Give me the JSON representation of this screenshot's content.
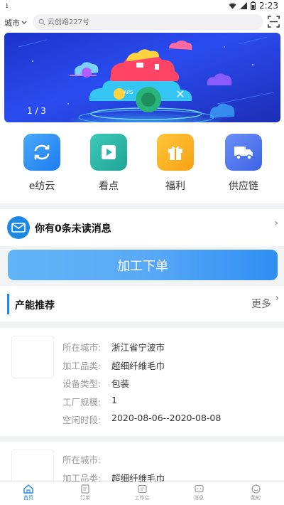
{
  "status_bar": {
    "time": "2:23",
    "download_icon": "download-icon"
  },
  "header": {
    "city_label": "城市",
    "search_placeholder": "云创路227号"
  },
  "banner": {
    "indicator": "1 / 3",
    "cloud_labels": {
      "aps": "APS"
    }
  },
  "quick_menu": [
    {
      "label": "e纺云",
      "icon": "sync-icon",
      "color": "#2f8ef3"
    },
    {
      "label": "看点",
      "icon": "play-icon",
      "color": "#2cb5a6"
    },
    {
      "label": "福利",
      "icon": "gift-icon",
      "color": "#fbb322"
    },
    {
      "label": "供应链",
      "icon": "truck-icon",
      "color": "#4a74ef"
    }
  ],
  "notice": {
    "text": "你有0条未读消息"
  },
  "process_button": {
    "label": "加工下单"
  },
  "section": {
    "title": "产能推荐",
    "more_label": "更多"
  },
  "cards": [
    {
      "rows": [
        {
          "label": "所在城市:",
          "value": "浙江省宁波市"
        },
        {
          "label": "加工品类:",
          "value": "超细纤维毛巾"
        },
        {
          "label": "设备类型:",
          "value": "包装"
        },
        {
          "label": "工厂规模:",
          "value": "1"
        },
        {
          "label": "空闲时段:",
          "value": "2020-08-06--2020-08-08"
        }
      ]
    },
    {
      "rows": [
        {
          "label": "所在城市:",
          "value": ""
        },
        {
          "label": "加工品类:",
          "value": "超细纤维毛巾"
        }
      ]
    }
  ],
  "tabs": [
    {
      "label": "首页",
      "icon": "home-icon",
      "active": true
    },
    {
      "label": "订单",
      "icon": "order-icon",
      "active": false
    },
    {
      "label": "工作台",
      "icon": "workbench-icon",
      "active": false
    },
    {
      "label": "消息",
      "icon": "message-icon",
      "active": false
    },
    {
      "label": "我的",
      "icon": "profile-icon",
      "active": false
    }
  ],
  "colors": {
    "accent": "#1e88e5",
    "banner_blue": "#2a4cf0"
  }
}
